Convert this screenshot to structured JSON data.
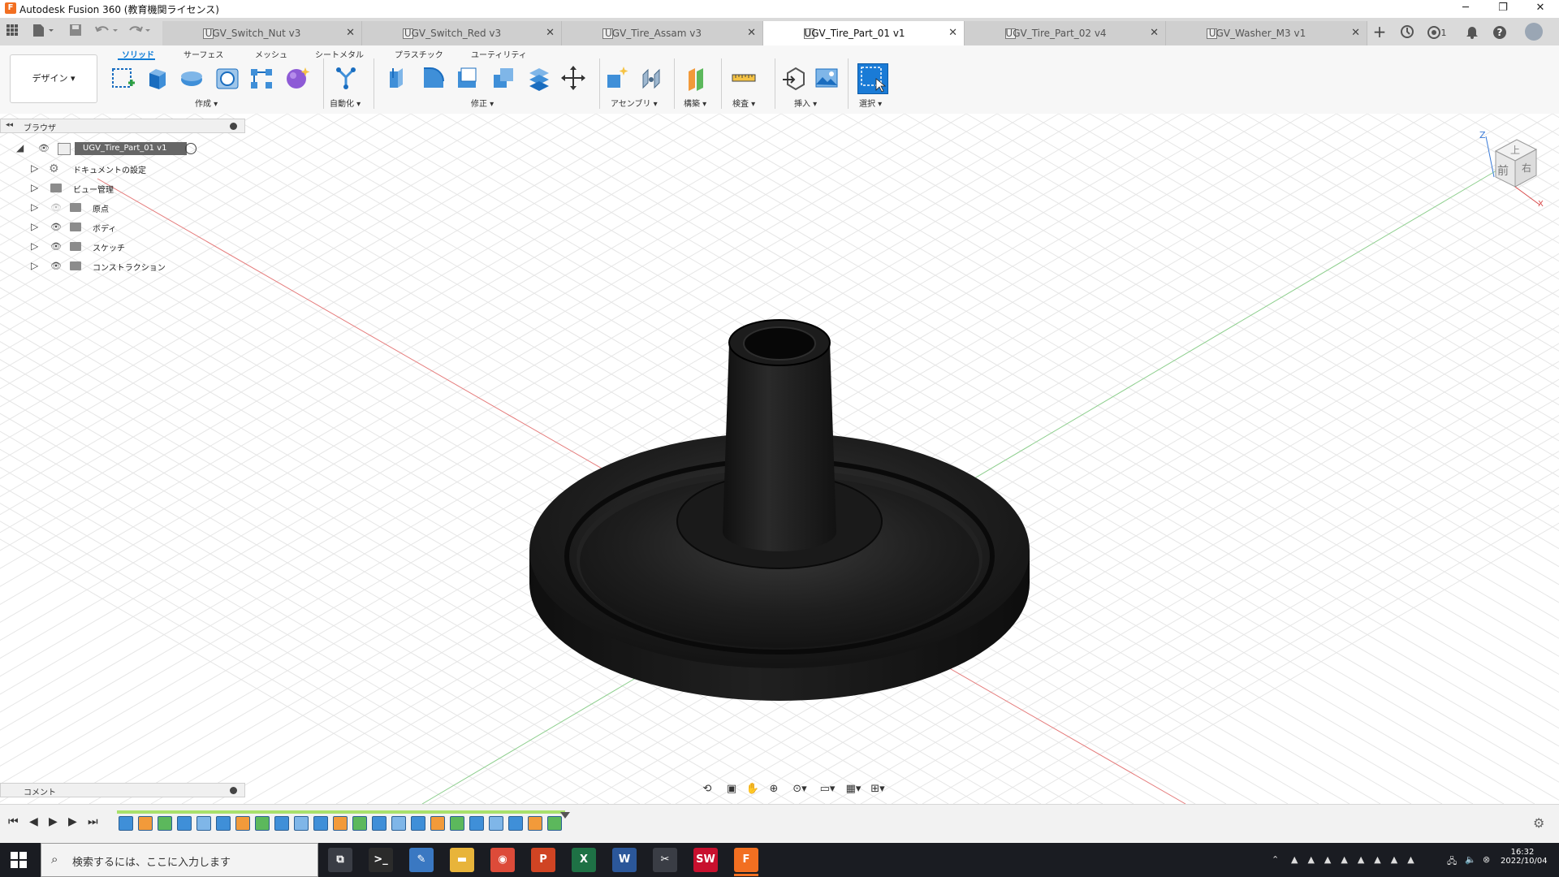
{
  "titlebar": {
    "title": "Autodesk Fusion 360 (教育機関ライセンス)",
    "logo_glyph": "F",
    "minimize": "─",
    "restore": "❐",
    "close": "✕"
  },
  "doc_tabs": [
    {
      "label": "UGV_Switch_Nut v3",
      "active": false,
      "close": "✕"
    },
    {
      "label": "UGV_Switch_Red v3",
      "active": false,
      "close": "✕"
    },
    {
      "label": "UGV_Tire_Assam v3",
      "active": false,
      "close": "✕"
    },
    {
      "label": "UGV_Tire_Part_01 v1",
      "active": true,
      "close": "✕"
    },
    {
      "label": "UGV_Tire_Part_02 v4",
      "active": false,
      "close": "✕"
    },
    {
      "label": "UGV_Washer_M3 v1",
      "active": false,
      "close": "✕"
    }
  ],
  "top_right": {
    "plus": "+",
    "job_count": "1",
    "help": "?"
  },
  "ribbon": {
    "tabs": [
      {
        "label": "ソリッド",
        "active": true
      },
      {
        "label": "サーフェス",
        "active": false
      },
      {
        "label": "メッシュ",
        "active": false
      },
      {
        "label": "シートメタル",
        "active": false
      },
      {
        "label": "プラスチック",
        "active": false
      },
      {
        "label": "ユーティリティ",
        "active": false
      }
    ],
    "workspace_button": "デザイン ▾",
    "groups": {
      "create": "作成 ▾",
      "automate": "自動化 ▾",
      "modify": "修正 ▾",
      "assemble": "アセンブリ ▾",
      "construct": "構築 ▾",
      "inspect": "検査 ▾",
      "insert": "挿入 ▾",
      "select": "選択 ▾"
    }
  },
  "browser": {
    "header": "ブラウザ",
    "collapse_glyph": "◂◂",
    "root": "UGV_Tire_Part_01 v1",
    "items": [
      {
        "label": "ドキュメントの設定"
      },
      {
        "label": "ビュー管理"
      },
      {
        "label": "原点"
      },
      {
        "label": "ボディ"
      },
      {
        "label": "スケッチ"
      },
      {
        "label": "コンストラクション"
      }
    ]
  },
  "viewcube": {
    "top": "上",
    "front": "前",
    "right": "右",
    "axis_z": "Z",
    "axis_x": "X"
  },
  "comment": {
    "label": "コメント"
  },
  "timeline": {
    "first": "⏮",
    "prev": "◀",
    "play": "▶",
    "next": "▶",
    "last": "⏭"
  },
  "taskbar": {
    "search_placeholder": "検索するには、ここに入力します",
    "time": "16:32",
    "date": "2022/10/04",
    "apps": [
      {
        "name": "task-view",
        "glyph": "⧉",
        "color": "#3a3d45"
      },
      {
        "name": "terminal",
        "glyph": ">_",
        "color": "#2b2b2b"
      },
      {
        "name": "notepad",
        "glyph": "✎",
        "color": "#3a78c2"
      },
      {
        "name": "explorer",
        "glyph": "▬",
        "color": "#e8b43a"
      },
      {
        "name": "chrome",
        "glyph": "◉",
        "color": "#dd4b39"
      },
      {
        "name": "powerpoint",
        "glyph": "P",
        "color": "#d04423"
      },
      {
        "name": "excel",
        "glyph": "X",
        "color": "#1e7145"
      },
      {
        "name": "word",
        "glyph": "W",
        "color": "#2b579a"
      },
      {
        "name": "paint",
        "glyph": "✂",
        "color": "#3a3d45"
      },
      {
        "name": "solidworks",
        "glyph": "SW",
        "color": "#c8102e"
      },
      {
        "name": "fusion",
        "glyph": "F",
        "color": "#f26f21"
      }
    ]
  },
  "colors": {
    "accent": "#0c7bd6",
    "fusion_orange": "#f26f21",
    "grid_line": "#e6e6e6",
    "axis_x": "#e06060",
    "axis_y": "#6cc06c"
  }
}
